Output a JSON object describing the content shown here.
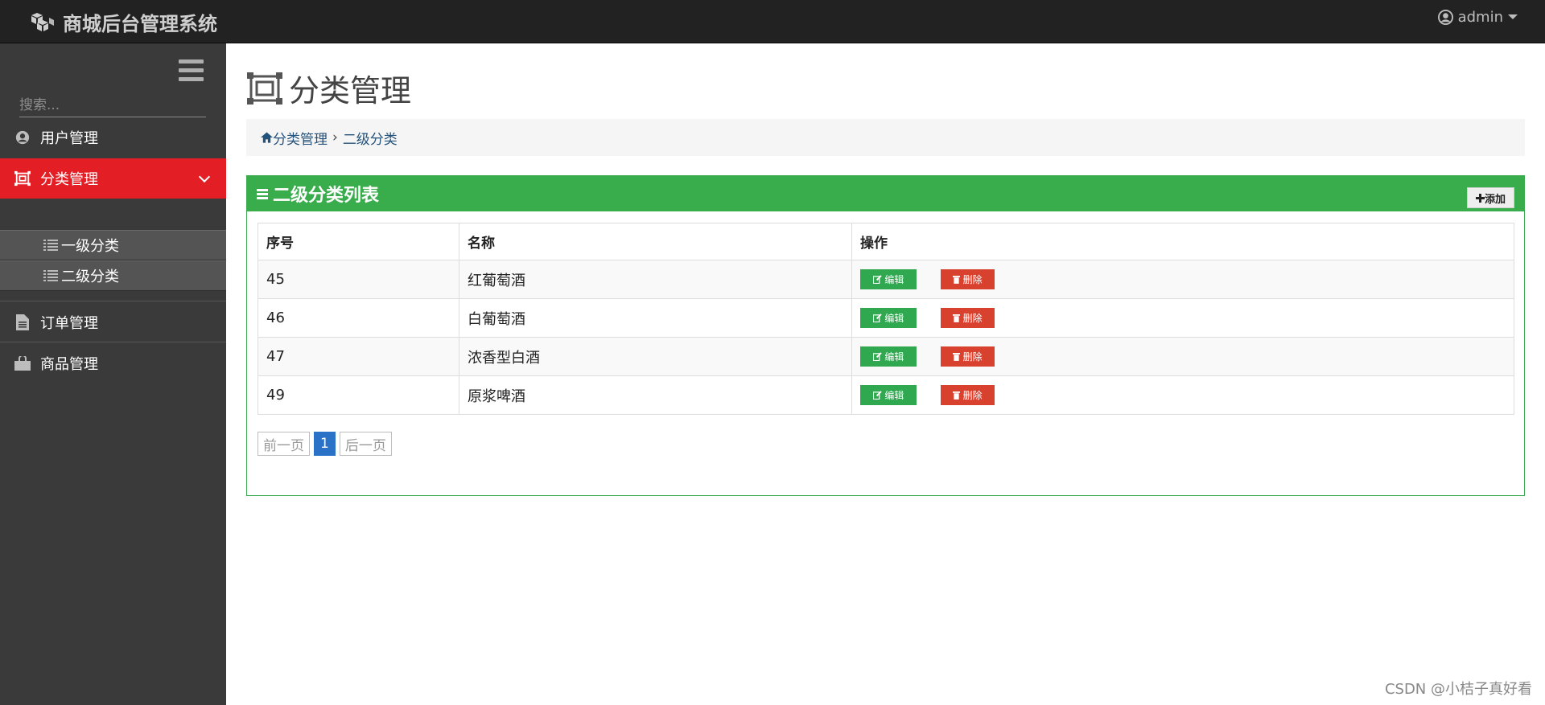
{
  "header": {
    "brand": "商城后台管理系统",
    "user": "admin"
  },
  "sidebar": {
    "search_placeholder": "搜索...",
    "items": [
      {
        "label": "用户管理",
        "icon": "user-circle-icon"
      },
      {
        "label": "分类管理",
        "icon": "crop-icon",
        "active": true
      },
      {
        "label": "订单管理",
        "icon": "file-icon"
      },
      {
        "label": "商品管理",
        "icon": "shopping-bag-icon"
      }
    ],
    "subitems": [
      {
        "label": "一级分类",
        "icon": "list-icon"
      },
      {
        "label": "二级分类",
        "icon": "list-icon"
      }
    ]
  },
  "page": {
    "title": "分类管理",
    "breadcrumb": {
      "home": "分类管理",
      "current": "二级分类"
    }
  },
  "panel": {
    "title": "二级分类列表",
    "add_label": "添加",
    "columns": [
      "序号",
      "名称",
      "操作"
    ],
    "rows": [
      {
        "id": "45",
        "name": "红葡萄酒"
      },
      {
        "id": "46",
        "name": "白葡萄酒"
      },
      {
        "id": "47",
        "name": "浓香型白酒"
      },
      {
        "id": "49",
        "name": "原浆啤酒"
      }
    ],
    "edit_label": "编辑",
    "delete_label": "删除"
  },
  "pagination": {
    "prev": "前一页",
    "current": "1",
    "next": "后一页"
  },
  "watermark": "CSDN @小桔子真好看",
  "colors": {
    "topbar": "#222222",
    "sidebar": "#3a3a3a",
    "active": "#e31e24",
    "panel": "#39ac4c",
    "edit": "#2fa84f",
    "delete": "#d9412f"
  }
}
